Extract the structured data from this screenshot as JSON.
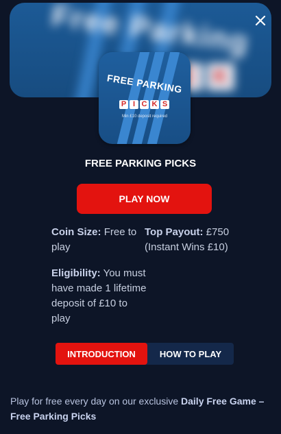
{
  "hero": {
    "title": "Free Parking",
    "tiles": [
      "P",
      "I",
      "C",
      "K"
    ]
  },
  "close": {
    "icon": "close-icon"
  },
  "thumbnail": {
    "title": "FREE PARKING",
    "tiles": [
      "P",
      "I",
      "C",
      "K",
      "S"
    ],
    "note": "Min £10 deposit required"
  },
  "game": {
    "title": "FREE PARKING PICKS",
    "play_label": "PLAY NOW"
  },
  "info": {
    "coin_size_label": "Coin Size:",
    "coin_size_value": "Free to play",
    "top_payout_label": "Top Payout:",
    "top_payout_value": "£750 (Instant Wins £10)",
    "eligibility_label": "Eligibility:",
    "eligibility_value": "You must have made 1 lifetime deposit of £10 to play"
  },
  "tabs": [
    {
      "label": "INTRODUCTION",
      "active": true
    },
    {
      "label": "HOW TO PLAY",
      "active": false
    }
  ],
  "description": {
    "text": "Play for free every day on our exclusive",
    "highlight": "Daily Free Game – Free Parking Picks"
  },
  "colors": {
    "background": "#0d1527",
    "accent": "#e3130f",
    "tab_bg": "#14284a",
    "banner_blue": "#1c5a96"
  }
}
